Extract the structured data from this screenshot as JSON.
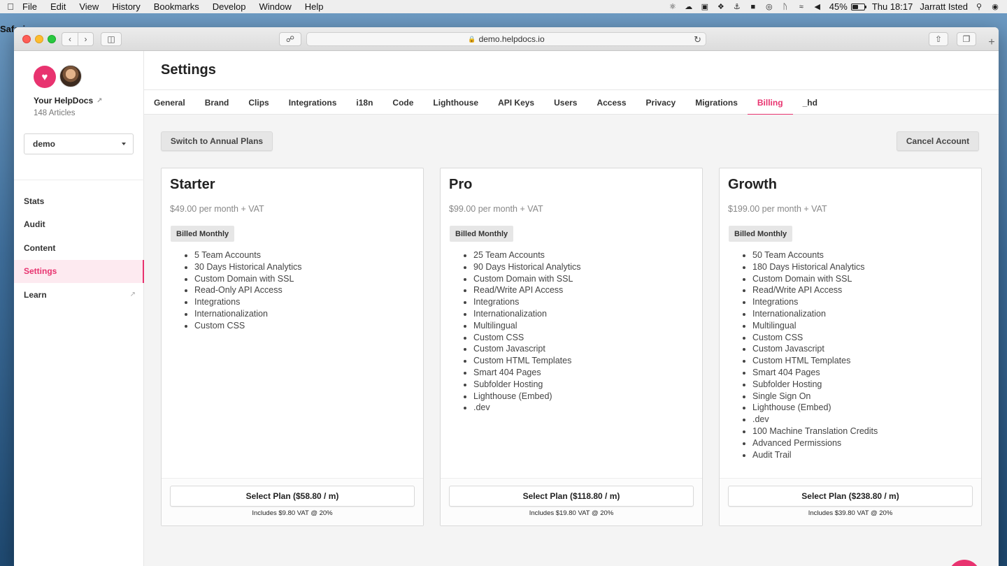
{
  "menubar": {
    "app": "Safari",
    "items": [
      "File",
      "Edit",
      "View",
      "History",
      "Bookmarks",
      "Develop",
      "Window",
      "Help"
    ],
    "battery_pct": "45%",
    "battery_level": 0.45,
    "clock": "Thu 18:17",
    "user": "Jarratt Isted"
  },
  "browser": {
    "url": "demo.helpdocs.io"
  },
  "sidebar": {
    "org_name": "Your HelpDocs",
    "article_count": "148 Articles",
    "select_value": "demo",
    "nav": [
      {
        "label": "Stats"
      },
      {
        "label": "Audit"
      },
      {
        "label": "Content"
      },
      {
        "label": "Settings"
      },
      {
        "label": "Learn"
      }
    ]
  },
  "page": {
    "title": "Settings",
    "tabs": [
      "General",
      "Brand",
      "Clips",
      "Integrations",
      "i18n",
      "Code",
      "Lighthouse",
      "API Keys",
      "Users",
      "Access",
      "Privacy",
      "Migrations",
      "Billing",
      "_hd"
    ],
    "active_tab": "Billing",
    "annual_button": "Switch to Annual Plans",
    "cancel_button": "Cancel Account"
  },
  "plans": [
    {
      "name": "Starter",
      "price": "$49.00 per month + VAT",
      "badge": "Billed Monthly",
      "features": [
        "5 Team Accounts",
        "30 Days Historical Analytics",
        "Custom Domain with SSL",
        "Read-Only API Access",
        "Integrations",
        "Internationalization",
        "Custom CSS"
      ],
      "button": "Select Plan ($58.80 / m)",
      "vat_note": "Includes $9.80 VAT @ 20%"
    },
    {
      "name": "Pro",
      "price": "$99.00 per month + VAT",
      "badge": "Billed Monthly",
      "features": [
        "25 Team Accounts",
        "90 Days Historical Analytics",
        "Custom Domain with SSL",
        "Read/Write API Access",
        "Integrations",
        "Internationalization",
        "Multilingual",
        "Custom CSS",
        "Custom Javascript",
        "Custom HTML Templates",
        "Smart 404 Pages",
        "Subfolder Hosting",
        "Lighthouse (Embed)",
        ".dev"
      ],
      "button": "Select Plan ($118.80 / m)",
      "vat_note": "Includes $19.80 VAT @ 20%"
    },
    {
      "name": "Growth",
      "price": "$199.00 per month + VAT",
      "badge": "Billed Monthly",
      "features": [
        "50 Team Accounts",
        "180 Days Historical Analytics",
        "Custom Domain with SSL",
        "Read/Write API Access",
        "Integrations",
        "Internationalization",
        "Multilingual",
        "Custom CSS",
        "Custom Javascript",
        "Custom HTML Templates",
        "Smart 404 Pages",
        "Subfolder Hosting",
        "Single Sign On",
        "Lighthouse (Embed)",
        ".dev",
        "100 Machine Translation Credits",
        "Advanced Permissions",
        "Audit Trail"
      ],
      "button": "Select Plan ($238.80 / m)",
      "vat_note": "Includes $39.80 VAT @ 20%"
    }
  ],
  "colors": {
    "accent": "#e8336f",
    "active_nav_bg": "#fdeaf0"
  }
}
